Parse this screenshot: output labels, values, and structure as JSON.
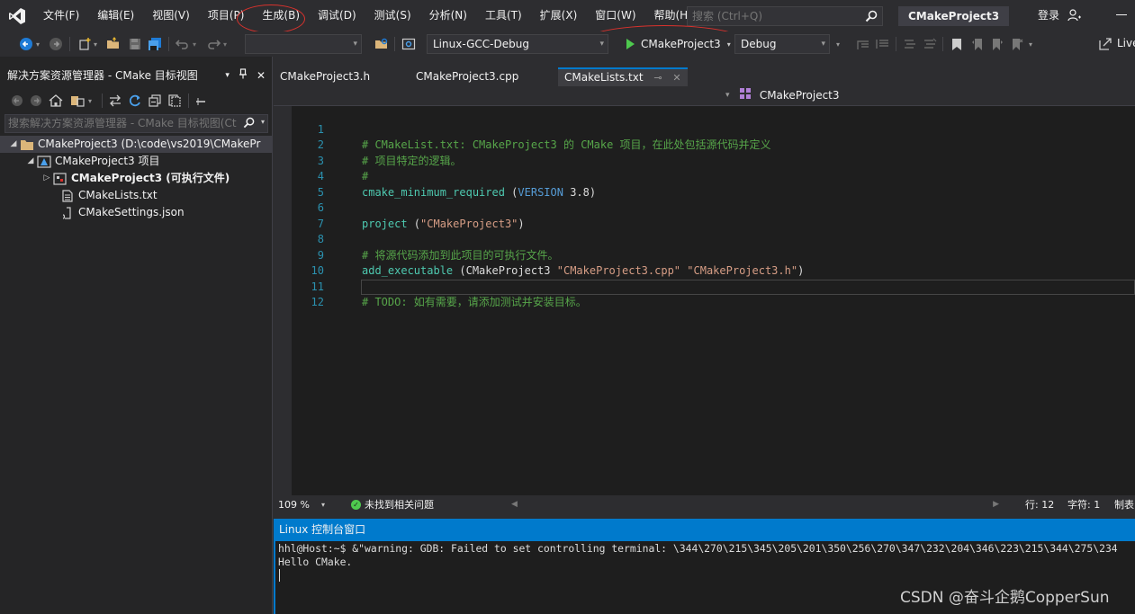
{
  "menu": {
    "items": [
      "文件(F)",
      "编辑(E)",
      "视图(V)",
      "项目(P)",
      "生成(B)",
      "调试(D)",
      "测试(S)",
      "分析(N)",
      "工具(T)",
      "扩展(X)",
      "窗口(W)",
      "帮助(H)"
    ],
    "search_placeholder": "搜索 (Ctrl+Q)",
    "project_name": "CMakeProject3",
    "login": "登录"
  },
  "toolbar": {
    "config_empty": "",
    "target_system": "Linux-GCC-Debug",
    "run_target": "CMakeProject3",
    "build_config": "Debug",
    "live_share": "Live"
  },
  "explorer": {
    "title": "解决方案资源管理器 - CMake 目标视图",
    "search_placeholder": "搜索解决方案资源管理器 - CMake 目标视图(Ct",
    "tree": {
      "root": "CMakeProject3 (D:\\code\\vs2019\\CMakePr",
      "project": "CMakeProject3 项目",
      "executable": "CMakeProject3 (可执行文件)",
      "file1": "CMakeLists.txt",
      "file2": "CMakeSettings.json"
    }
  },
  "tabs": {
    "t1": "CMakeProject3.h",
    "t2": "CMakeProject3.cpp",
    "t3": "CMakeLists.txt"
  },
  "navbar": {
    "scope": "CMakeProject3"
  },
  "editor": {
    "line_numbers": [
      "1",
      "2",
      "3",
      "4",
      "5",
      "6",
      "7",
      "8",
      "9",
      "10",
      "11",
      "12"
    ],
    "l1": "# CMakeList.txt: CMakeProject3 的 CMake 项目，在此处包括源代码并定义",
    "l2": "# 项目特定的逻辑。",
    "l3": "#",
    "l4_func": "cmake_minimum_required",
    "l4_open": " (",
    "l4_kw": "VERSION",
    "l4_val": " 3.8",
    "l4_close": ")",
    "l6_func": "project",
    "l6_open": " (",
    "l6_str": "\"CMakeProject3\"",
    "l6_close": ")",
    "l8": "# 将源代码添加到此项目的可执行文件。",
    "l9_func": "add_executable",
    "l9_open": " (CMakeProject3 ",
    "l9_str1": "\"CMakeProject3.cpp\"",
    "l9_sp": " ",
    "l9_str2": "\"CMakeProject3.h\"",
    "l9_close": ")",
    "l11": "# TODO: 如有需要，请添加测试并安装目标。"
  },
  "status": {
    "zoom": "109 %",
    "problems": "未找到相关问题",
    "line": "行: 12",
    "col": "字符: 1",
    "tab": "制表"
  },
  "console": {
    "title": "Linux 控制台窗口",
    "line1": "hhl@Host:~$ &\"warning: GDB: Failed to set controlling terminal: \\344\\270\\215\\345\\205\\201\\350\\256\\270\\347\\232\\204\\346\\223\\215\\344\\275\\234",
    "line2": "Hello CMake."
  },
  "watermark": "CSDN @奋斗企鹅CopperSun",
  "colors": {
    "accent": "#007acc",
    "annotation": "#d9322d",
    "comment": "#57a64a",
    "function": "#4ec9b0",
    "keyword": "#569cd6",
    "string": "#d69d85",
    "line_number": "#2b91af"
  }
}
